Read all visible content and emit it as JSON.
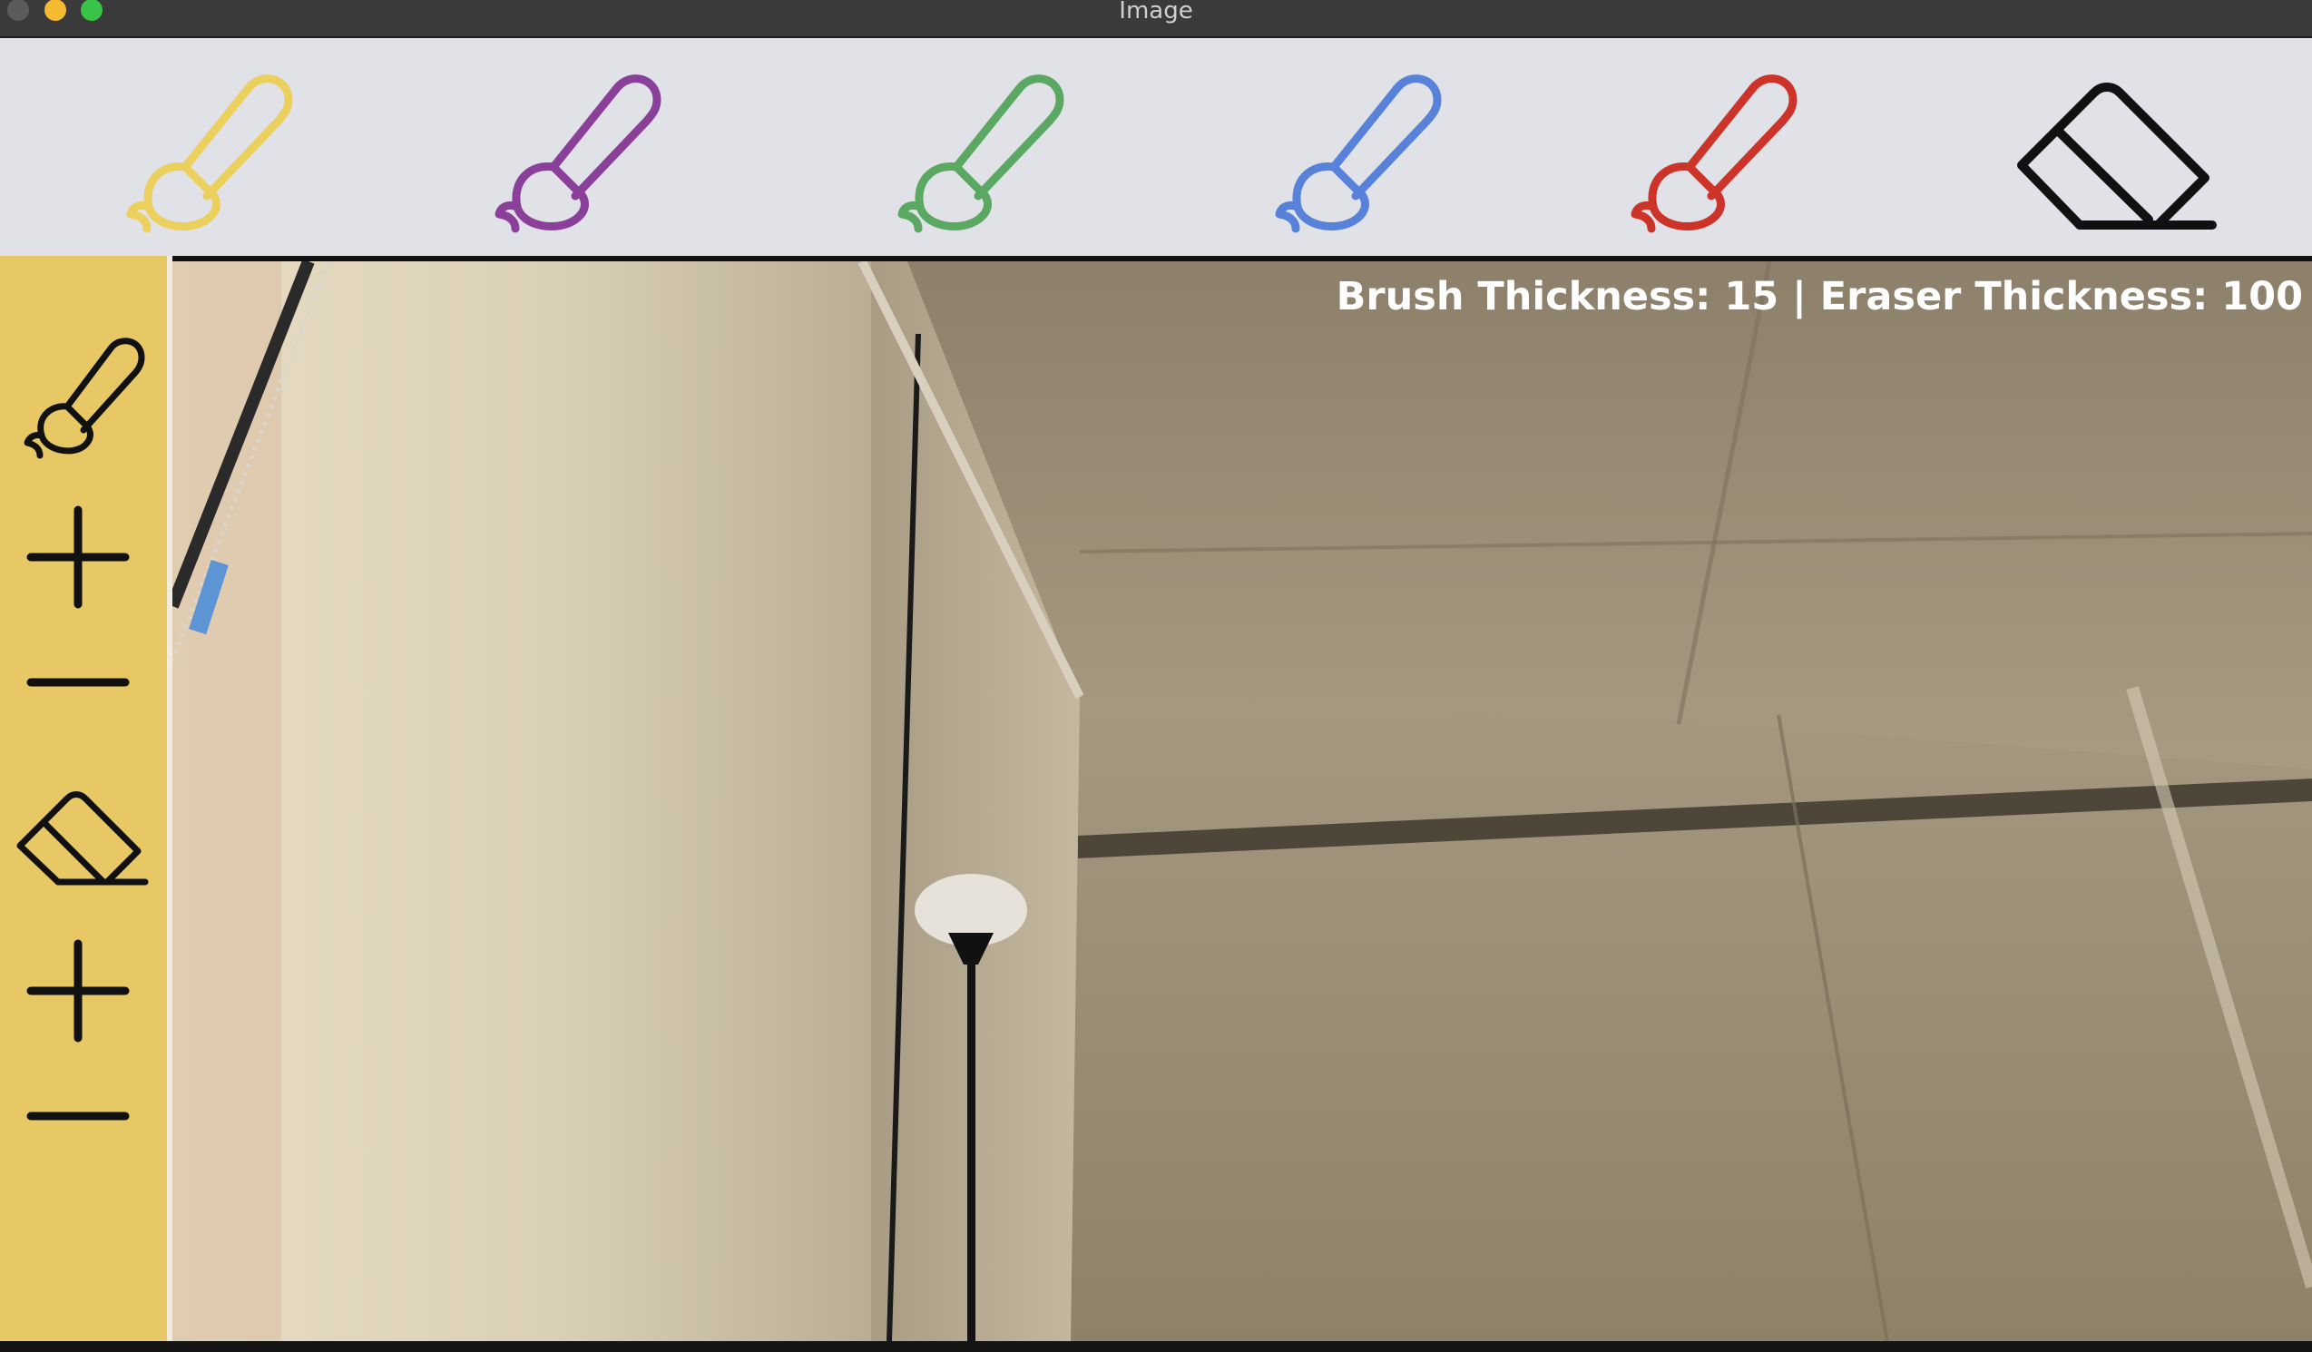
{
  "window": {
    "title": "Image"
  },
  "toolbar": {
    "tools": [
      {
        "name": "yellow-brush-icon",
        "color": "#ecd05e"
      },
      {
        "name": "purple-brush-icon",
        "color": "#8a3f99"
      },
      {
        "name": "green-brush-icon",
        "color": "#5ba862"
      },
      {
        "name": "blue-brush-icon",
        "color": "#5881da"
      },
      {
        "name": "red-brush-icon",
        "color": "#cc3429"
      },
      {
        "name": "eraser-icon",
        "color": "#111111"
      }
    ]
  },
  "sidepanel": {
    "background": "#e8c865",
    "items": [
      "brush-icon",
      "brush-increase-icon",
      "brush-decrease-icon",
      "eraser-icon",
      "eraser-increase-icon",
      "eraser-decrease-icon"
    ]
  },
  "hud": {
    "text": "Brush Thickness: 15 | Eraser Thickness: 100"
  }
}
